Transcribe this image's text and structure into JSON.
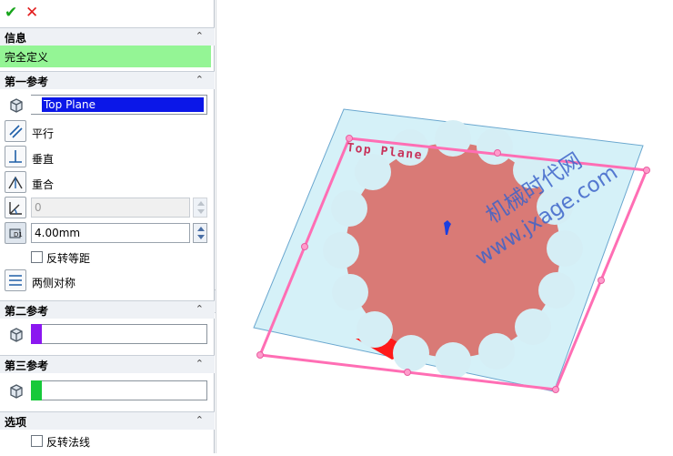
{
  "toolbar": {
    "ok_glyph": "✔",
    "cancel_glyph": "✕"
  },
  "info": {
    "title": "信息",
    "status": "完全定义"
  },
  "ref1": {
    "title": "第一参考",
    "selection": "Top Plane",
    "parallel": "平行",
    "perpendicular": "垂直",
    "coincident": "重合",
    "angle_value": "0",
    "offset_value": "4.00mm",
    "flip_offset": "反转等距",
    "mid_plane": "两侧对称",
    "swatch_color": "#f07ab8"
  },
  "ref2": {
    "title": "第二参考",
    "swatch_color": "#8b17f0"
  },
  "ref3": {
    "title": "第三参考",
    "swatch_color": "#17c93a"
  },
  "options": {
    "title": "选项",
    "flip_normal": "反转法线"
  },
  "viewport": {
    "plane_label": "Top Plane",
    "watermark_cn": "机械时代网",
    "watermark_url": "www.jxage.com",
    "plane_color": "#c7ecf5",
    "frame_color": "#ff6eb4",
    "part_color": "#d97a76",
    "underside_color": "#ff1a1a"
  },
  "icons": {
    "collapse": "chevron-up-icon",
    "cube": "plane-cube-icon",
    "parallel": "parallel-icon",
    "perpendicular": "perpendicular-icon",
    "coincident": "coincident-icon",
    "angle": "angle-icon",
    "distance": "distance-icon",
    "midplane": "midplane-icon"
  }
}
